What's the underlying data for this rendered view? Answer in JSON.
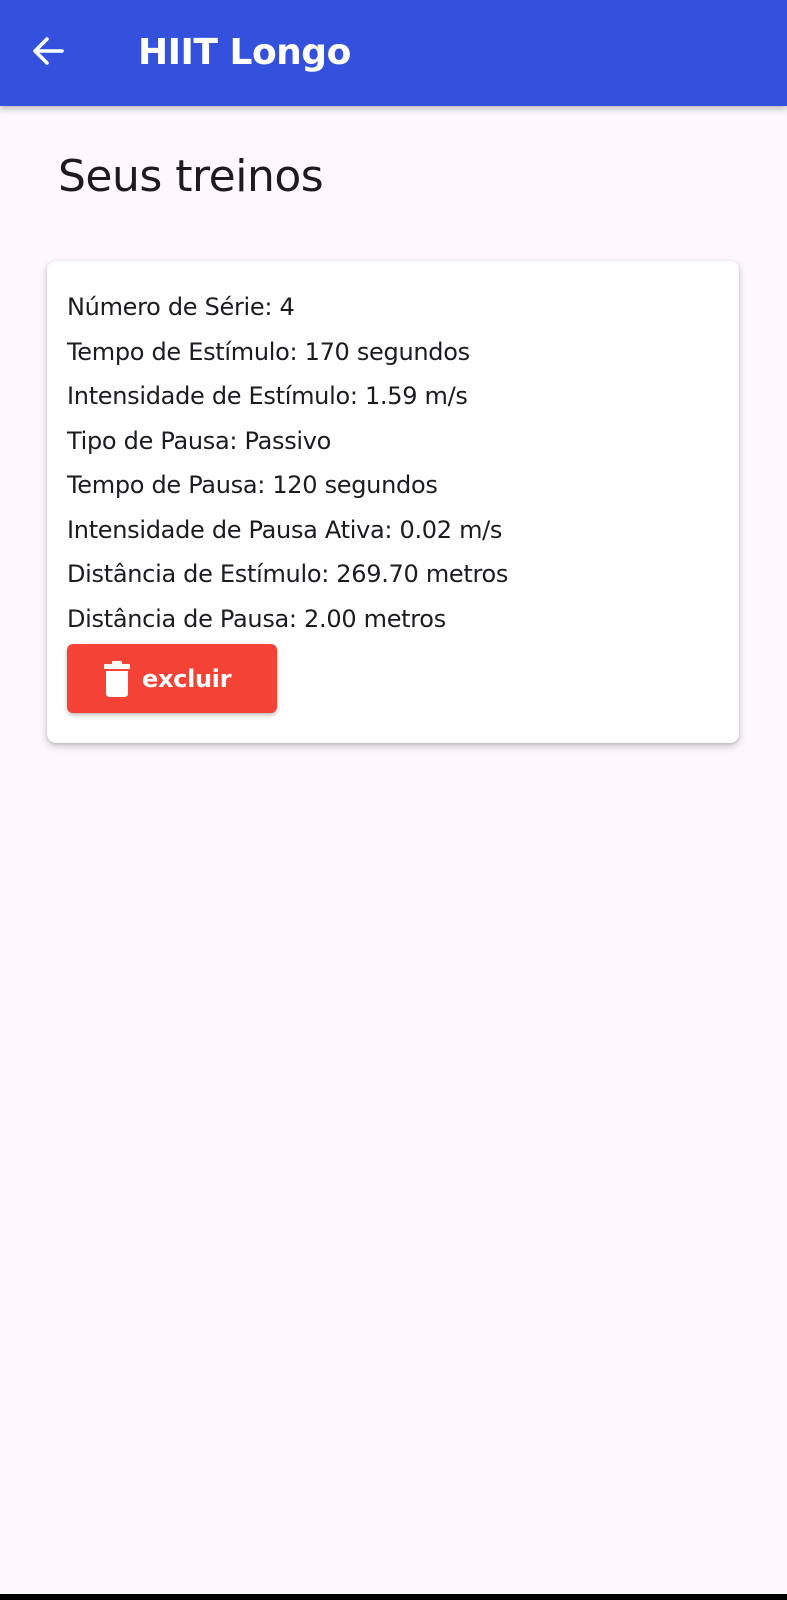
{
  "app_bar": {
    "title": "HIIT Longo",
    "back_icon": "arrow-left-icon",
    "color": "#3451de"
  },
  "page": {
    "title": "Seus treinos",
    "background": "#fdf8fc"
  },
  "workout_card": {
    "lines": [
      "Número de Série: 4",
      "Tempo de Estímulo: 170 segundos",
      "Intensidade de Estímulo: 1.59 m/s",
      "Tipo de Pausa: Passivo",
      "Tempo de Pausa: 120 segundos",
      "Intensidade de Pausa Ativa: 0.02 m/s",
      "Distância de Estímulo: 269.70 metros",
      "Distância de Pausa: 2.00 metros"
    ],
    "delete_button": {
      "label": "excluir",
      "icon": "trash-icon",
      "color": "#f44336"
    }
  }
}
